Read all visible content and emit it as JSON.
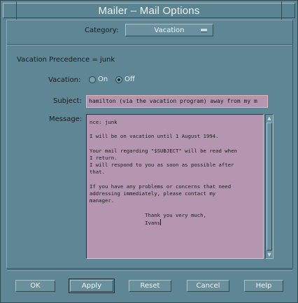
{
  "window": {
    "title": "Mailer – Mail Options"
  },
  "category": {
    "label": "Category:",
    "selected": "Vacation"
  },
  "vacation_precedence": {
    "text": "Vacation Precedence = junk"
  },
  "vacation": {
    "label": "Vacation:",
    "options": [
      {
        "label": "On",
        "checked": false
      },
      {
        "label": "Off",
        "checked": true
      }
    ]
  },
  "subject": {
    "label": "Subject:",
    "value": "hamilton (via the vacation program) away from my m"
  },
  "message": {
    "label": "Message:",
    "lines": [
      "nce: junk",
      "",
      "I will be on vacation until 1 August 1994.",
      "",
      "Your mail regarding \"$SUBJECT\" will be read when",
      "I return.",
      "I will respond to you as soon as possible after",
      "that.",
      "",
      "If you have any problems or concerns that need",
      "addressing immediately, please contact my",
      "manager.",
      "",
      "                  Thank you very much,",
      "                  Ivans"
    ]
  },
  "buttons": {
    "ok": "OK",
    "apply": "Apply",
    "reset": "Reset",
    "cancel": "Cancel",
    "help": "Help"
  },
  "colors": {
    "background": "#5f8694",
    "field": "#b496b0",
    "field_border": "#e7b6b8",
    "text": "#1b1b1b"
  }
}
